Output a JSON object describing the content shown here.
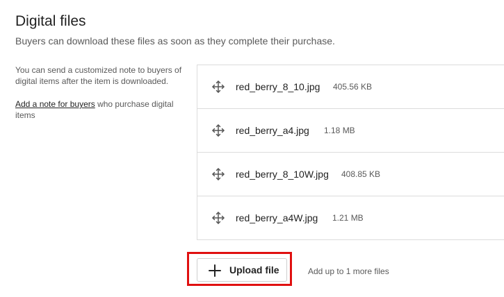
{
  "header": {
    "title": "Digital files",
    "subtitle": "Buyers can download these files as soon as they complete their purchase."
  },
  "side_note": {
    "text": "You can send a customized note to buyers of digital items after the item is downloaded.",
    "link_label": "Add a note for buyers",
    "link_suffix": " who purchase digital items"
  },
  "files": [
    {
      "name": "red_berry_8_10.jpg",
      "size": "405.56 KB",
      "icon": "move-icon"
    },
    {
      "name": "red_berry_a4.jpg",
      "size": "1.18 MB",
      "icon": "move-icon"
    },
    {
      "name": "red_berry_8_10W.jpg",
      "size": "408.85 KB",
      "icon": "move-icon"
    },
    {
      "name": "red_berry_a4W.jpg",
      "size": "1.21 MB",
      "icon": "move-icon"
    }
  ],
  "upload": {
    "button_label": "Upload file",
    "button_icon": "plus-icon",
    "hint": "Add up to 1 more files",
    "highlight_color": "#e01010"
  }
}
